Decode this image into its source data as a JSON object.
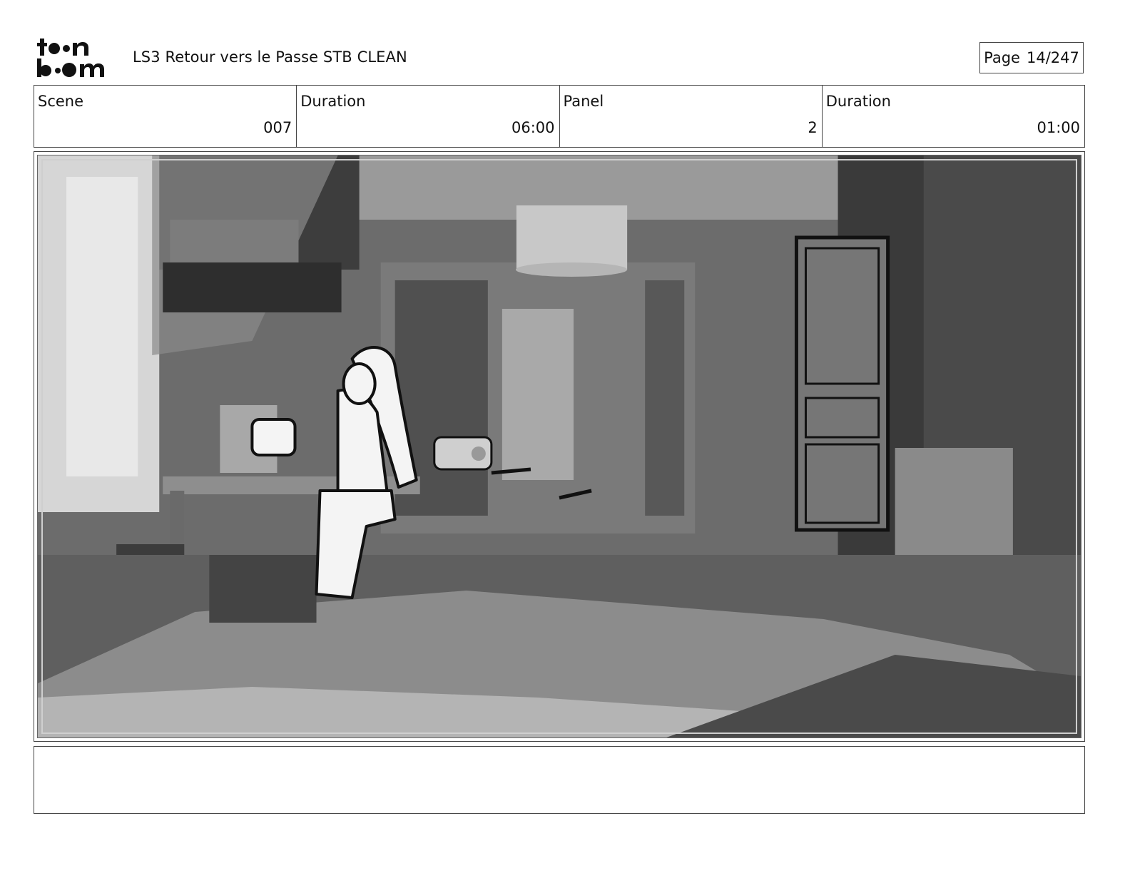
{
  "header": {
    "logo_text": "toon boom",
    "document_title": "LS3 Retour vers le Passe STB CLEAN",
    "page_label": "Page",
    "page_number": "14/247"
  },
  "info": {
    "scene_label": "Scene",
    "scene_value": "007",
    "scene_duration_label": "Duration",
    "scene_duration_value": "06:00",
    "panel_label": "Panel",
    "panel_value": "2",
    "panel_duration_label": "Duration",
    "panel_duration_value": "01:00"
  },
  "panel": {
    "image_subject": "storyboard-panel-bedroom",
    "background_tone": "#6e6e6e"
  },
  "notes": {
    "text": ""
  }
}
